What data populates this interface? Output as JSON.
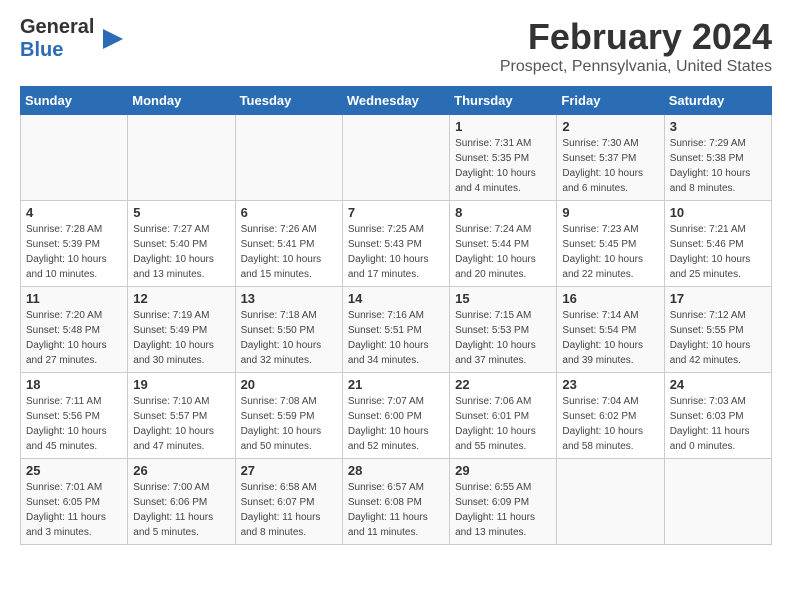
{
  "logo": {
    "text_general": "General",
    "text_blue": "Blue"
  },
  "header": {
    "title": "February 2024",
    "subtitle": "Prospect, Pennsylvania, United States"
  },
  "weekdays": [
    "Sunday",
    "Monday",
    "Tuesday",
    "Wednesday",
    "Thursday",
    "Friday",
    "Saturday"
  ],
  "weeks": [
    [
      {
        "day": "",
        "info": ""
      },
      {
        "day": "",
        "info": ""
      },
      {
        "day": "",
        "info": ""
      },
      {
        "day": "",
        "info": ""
      },
      {
        "day": "1",
        "info": "Sunrise: 7:31 AM\nSunset: 5:35 PM\nDaylight: 10 hours\nand 4 minutes."
      },
      {
        "day": "2",
        "info": "Sunrise: 7:30 AM\nSunset: 5:37 PM\nDaylight: 10 hours\nand 6 minutes."
      },
      {
        "day": "3",
        "info": "Sunrise: 7:29 AM\nSunset: 5:38 PM\nDaylight: 10 hours\nand 8 minutes."
      }
    ],
    [
      {
        "day": "4",
        "info": "Sunrise: 7:28 AM\nSunset: 5:39 PM\nDaylight: 10 hours\nand 10 minutes."
      },
      {
        "day": "5",
        "info": "Sunrise: 7:27 AM\nSunset: 5:40 PM\nDaylight: 10 hours\nand 13 minutes."
      },
      {
        "day": "6",
        "info": "Sunrise: 7:26 AM\nSunset: 5:41 PM\nDaylight: 10 hours\nand 15 minutes."
      },
      {
        "day": "7",
        "info": "Sunrise: 7:25 AM\nSunset: 5:43 PM\nDaylight: 10 hours\nand 17 minutes."
      },
      {
        "day": "8",
        "info": "Sunrise: 7:24 AM\nSunset: 5:44 PM\nDaylight: 10 hours\nand 20 minutes."
      },
      {
        "day": "9",
        "info": "Sunrise: 7:23 AM\nSunset: 5:45 PM\nDaylight: 10 hours\nand 22 minutes."
      },
      {
        "day": "10",
        "info": "Sunrise: 7:21 AM\nSunset: 5:46 PM\nDaylight: 10 hours\nand 25 minutes."
      }
    ],
    [
      {
        "day": "11",
        "info": "Sunrise: 7:20 AM\nSunset: 5:48 PM\nDaylight: 10 hours\nand 27 minutes."
      },
      {
        "day": "12",
        "info": "Sunrise: 7:19 AM\nSunset: 5:49 PM\nDaylight: 10 hours\nand 30 minutes."
      },
      {
        "day": "13",
        "info": "Sunrise: 7:18 AM\nSunset: 5:50 PM\nDaylight: 10 hours\nand 32 minutes."
      },
      {
        "day": "14",
        "info": "Sunrise: 7:16 AM\nSunset: 5:51 PM\nDaylight: 10 hours\nand 34 minutes."
      },
      {
        "day": "15",
        "info": "Sunrise: 7:15 AM\nSunset: 5:53 PM\nDaylight: 10 hours\nand 37 minutes."
      },
      {
        "day": "16",
        "info": "Sunrise: 7:14 AM\nSunset: 5:54 PM\nDaylight: 10 hours\nand 39 minutes."
      },
      {
        "day": "17",
        "info": "Sunrise: 7:12 AM\nSunset: 5:55 PM\nDaylight: 10 hours\nand 42 minutes."
      }
    ],
    [
      {
        "day": "18",
        "info": "Sunrise: 7:11 AM\nSunset: 5:56 PM\nDaylight: 10 hours\nand 45 minutes."
      },
      {
        "day": "19",
        "info": "Sunrise: 7:10 AM\nSunset: 5:57 PM\nDaylight: 10 hours\nand 47 minutes."
      },
      {
        "day": "20",
        "info": "Sunrise: 7:08 AM\nSunset: 5:59 PM\nDaylight: 10 hours\nand 50 minutes."
      },
      {
        "day": "21",
        "info": "Sunrise: 7:07 AM\nSunset: 6:00 PM\nDaylight: 10 hours\nand 52 minutes."
      },
      {
        "day": "22",
        "info": "Sunrise: 7:06 AM\nSunset: 6:01 PM\nDaylight: 10 hours\nand 55 minutes."
      },
      {
        "day": "23",
        "info": "Sunrise: 7:04 AM\nSunset: 6:02 PM\nDaylight: 10 hours\nand 58 minutes."
      },
      {
        "day": "24",
        "info": "Sunrise: 7:03 AM\nSunset: 6:03 PM\nDaylight: 11 hours\nand 0 minutes."
      }
    ],
    [
      {
        "day": "25",
        "info": "Sunrise: 7:01 AM\nSunset: 6:05 PM\nDaylight: 11 hours\nand 3 minutes."
      },
      {
        "day": "26",
        "info": "Sunrise: 7:00 AM\nSunset: 6:06 PM\nDaylight: 11 hours\nand 5 minutes."
      },
      {
        "day": "27",
        "info": "Sunrise: 6:58 AM\nSunset: 6:07 PM\nDaylight: 11 hours\nand 8 minutes."
      },
      {
        "day": "28",
        "info": "Sunrise: 6:57 AM\nSunset: 6:08 PM\nDaylight: 11 hours\nand 11 minutes."
      },
      {
        "day": "29",
        "info": "Sunrise: 6:55 AM\nSunset: 6:09 PM\nDaylight: 11 hours\nand 13 minutes."
      },
      {
        "day": "",
        "info": ""
      },
      {
        "day": "",
        "info": ""
      }
    ]
  ]
}
